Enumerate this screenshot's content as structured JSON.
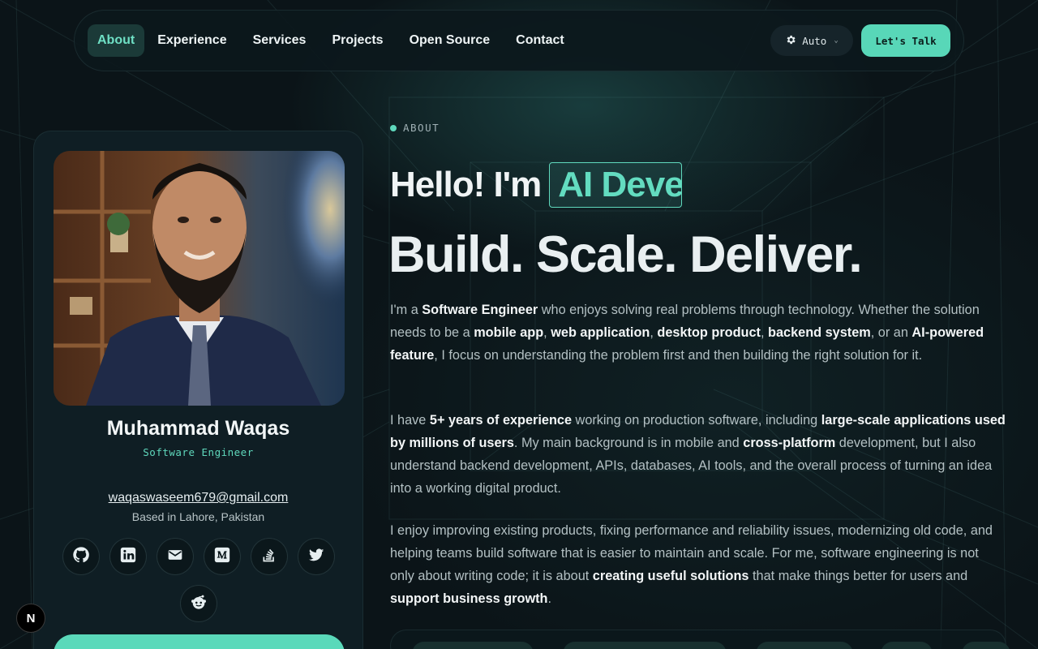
{
  "nav": {
    "links": [
      {
        "label": "About",
        "active": true
      },
      {
        "label": "Experience",
        "active": false
      },
      {
        "label": "Services",
        "active": false
      },
      {
        "label": "Projects",
        "active": false
      },
      {
        "label": "Open Source",
        "active": false
      },
      {
        "label": "Contact",
        "active": false
      }
    ],
    "theme_label": "Auto",
    "theme_icon": "gear-icon",
    "cta_label": "Let's Talk"
  },
  "profile": {
    "name": "Muhammad Waqas",
    "role": "Software Engineer",
    "email": "waqaswaseem679@gmail.com",
    "location": "Based in Lahore, Pakistan",
    "socials": [
      "github-icon",
      "linkedin-icon",
      "email-icon",
      "medium-icon",
      "stackoverflow-icon",
      "twitter-icon",
      "reddit-icon"
    ]
  },
  "hero": {
    "eyebrow": "ABOUT",
    "hello": "Hello! I'm",
    "typed": "AI Deve",
    "headline": "Build. Scale. Deliver."
  },
  "paragraphs": {
    "p1": [
      {
        "t": "I'm a "
      },
      {
        "t": "Software Engineer",
        "b": true
      },
      {
        "t": " who enjoys solving real problems through technology. Whether the solution needs to be a "
      },
      {
        "t": "mobile app",
        "b": true
      },
      {
        "t": ", "
      },
      {
        "t": "web application",
        "b": true
      },
      {
        "t": ", "
      },
      {
        "t": "desktop product",
        "b": true
      },
      {
        "t": ", "
      },
      {
        "t": "backend system",
        "b": true
      },
      {
        "t": ", or an "
      },
      {
        "t": "AI-powered feature",
        "b": true
      },
      {
        "t": ", I focus on understanding the problem first and then building the right solution for it."
      }
    ],
    "p2": [
      {
        "t": "I have "
      },
      {
        "t": "5+ years of experience",
        "b": true
      },
      {
        "t": " working on production software, including "
      },
      {
        "t": "large-scale applications used by millions of users",
        "b": true
      },
      {
        "t": ". My main background is in mobile and "
      },
      {
        "t": "cross-platform",
        "b": true
      },
      {
        "t": " development, but I also understand backend development, APIs, databases, AI tools, and the overall process of turning an idea into a working digital product."
      }
    ],
    "p3": [
      {
        "t": "I enjoy improving existing products, fixing performance and reliability issues, modernizing old code, and helping teams build software that is easier to maintain and scale. For me, software engineering is not only about writing code; it is about "
      },
      {
        "t": "creating useful solutions",
        "b": true
      },
      {
        "t": " that make things better for users and "
      },
      {
        "t": "support business growth",
        "b": true
      },
      {
        "t": "."
      }
    ]
  },
  "badge": "N",
  "colors": {
    "accent": "#5fd8bc",
    "background": "#0b1418",
    "card": "#0f1e24"
  }
}
